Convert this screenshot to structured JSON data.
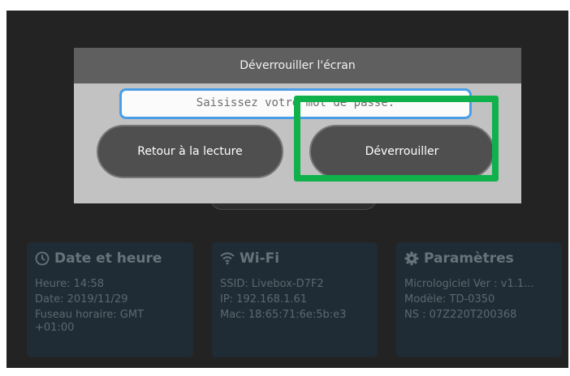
{
  "dialog": {
    "title": "Déverrouiller l'écran",
    "password_placeholder": "Saisissez votre mot de passe.",
    "back_button_label": "Retour à la lecture",
    "unlock_button_label": "Déverrouiller"
  },
  "cards": {
    "datetime": {
      "icon": "clock-icon",
      "title": "Date et heure",
      "time": "Heure: 14:58",
      "date": "Date: 2019/11/29",
      "timezone_line1": "Fuseau horaire: GMT",
      "timezone_line2": "+01:00"
    },
    "wifi": {
      "icon": "wifi-icon",
      "title": "Wi-Fi",
      "ssid": "SSID: Livebox-D7F2",
      "ip": "IP: 192.168.1.61",
      "mac": "Mac: 18:65:71:6e:5b:e3"
    },
    "settings": {
      "icon": "gear-icon",
      "title": "Paramètres",
      "firmware": "Micrologiciel Ver : v1.1...",
      "model": "Modèle: TD-0350",
      "serial": "NS : 07Z220T200368"
    }
  },
  "colors": {
    "highlight": "#10b14b",
    "input_border": "#4a9ee8",
    "dialog_header": "#5f5f5f",
    "dialog_body": "#c2c2c2",
    "button": "#4f4f4f"
  }
}
